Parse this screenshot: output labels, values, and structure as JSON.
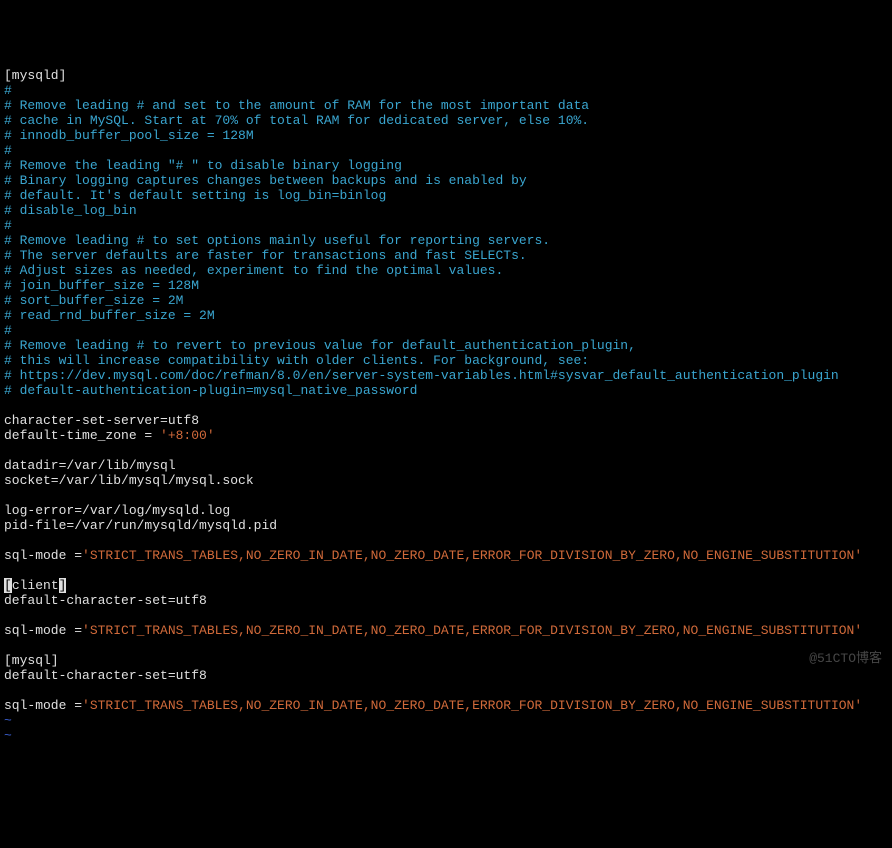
{
  "sections": {
    "mysqld": {
      "header": "[mysqld]",
      "comments": [
        "#",
        "# Remove leading # and set to the amount of RAM for the most important data",
        "# cache in MySQL. Start at 70% of total RAM for dedicated server, else 10%.",
        "# innodb_buffer_pool_size = 128M",
        "#",
        "# Remove the leading \"# \" to disable binary logging",
        "# Binary logging captures changes between backups and is enabled by",
        "# default. It's default setting is log_bin=binlog",
        "# disable_log_bin",
        "#",
        "# Remove leading # to set options mainly useful for reporting servers.",
        "# The server defaults are faster for transactions and fast SELECTs.",
        "# Adjust sizes as needed, experiment to find the optimal values.",
        "# join_buffer_size = 128M",
        "# sort_buffer_size = 2M",
        "# read_rnd_buffer_size = 2M",
        "#",
        "# Remove leading # to revert to previous value for default_authentication_plugin,",
        "# this will increase compatibility with older clients. For background, see:",
        "# https://dev.mysql.com/doc/refman/8.0/en/server-system-variables.html#sysvar_default_authentication_plugin",
        "# default-authentication-plugin=mysql_native_password"
      ],
      "settings": {
        "charset_line": "character-set-server=utf8",
        "tz_key": "default-time_zone = ",
        "tz_val": "'+8:00'",
        "datadir": "datadir=/var/lib/mysql",
        "socket": "socket=/var/lib/mysql/mysql.sock",
        "log_error": "log-error=/var/log/mysqld.log",
        "pid_file": "pid-file=/var/run/mysqld/mysqld.pid",
        "sqlmode_key": "sql-mode =",
        "sqlmode_val": "'STRICT_TRANS_TABLES,NO_ZERO_IN_DATE,NO_ZERO_DATE,ERROR_FOR_DIVISION_BY_ZERO,NO_ENGINE_SUBSTITUTION'"
      }
    },
    "client": {
      "header_open": "[",
      "header_name": "client",
      "header_close": "]",
      "charset": "default-character-set=utf8",
      "sqlmode_key": "sql-mode =",
      "sqlmode_val": "'STRICT_TRANS_TABLES,NO_ZERO_IN_DATE,NO_ZERO_DATE,ERROR_FOR_DIVISION_BY_ZERO,NO_ENGINE_SUBSTITUTION'"
    },
    "mysql": {
      "header": "[mysql]",
      "charset": "default-character-set=utf8",
      "sqlmode_key": "sql-mode =",
      "sqlmode_val": "'STRICT_TRANS_TABLES,NO_ZERO_IN_DATE,NO_ZERO_DATE,ERROR_FOR_DIVISION_BY_ZERO,NO_ENGINE_SUBSTITUTION'"
    }
  },
  "tildes": "~\n~",
  "watermark": "@51CTO博客"
}
